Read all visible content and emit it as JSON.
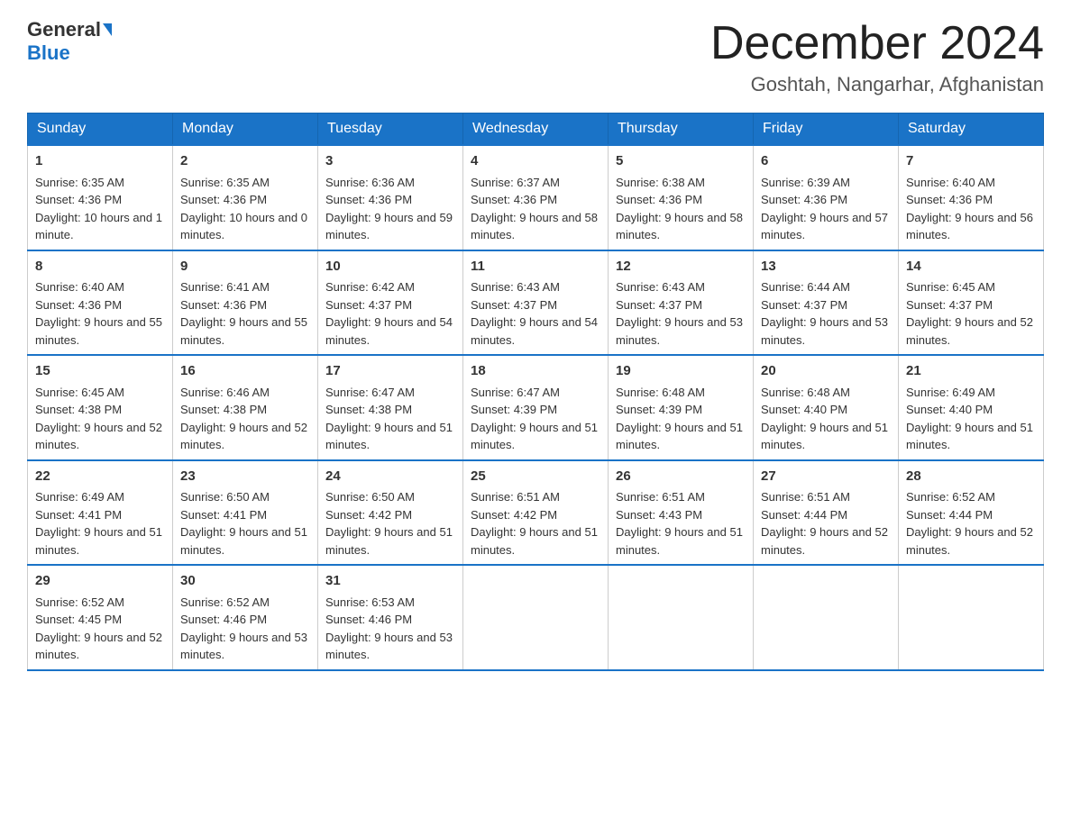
{
  "header": {
    "logo_general": "General",
    "logo_blue": "Blue",
    "month_title": "December 2024",
    "location": "Goshtah, Nangarhar, Afghanistan"
  },
  "weekdays": [
    "Sunday",
    "Monday",
    "Tuesday",
    "Wednesday",
    "Thursday",
    "Friday",
    "Saturday"
  ],
  "weeks": [
    [
      {
        "day": "1",
        "sunrise": "Sunrise: 6:35 AM",
        "sunset": "Sunset: 4:36 PM",
        "daylight": "Daylight: 10 hours and 1 minute."
      },
      {
        "day": "2",
        "sunrise": "Sunrise: 6:35 AM",
        "sunset": "Sunset: 4:36 PM",
        "daylight": "Daylight: 10 hours and 0 minutes."
      },
      {
        "day": "3",
        "sunrise": "Sunrise: 6:36 AM",
        "sunset": "Sunset: 4:36 PM",
        "daylight": "Daylight: 9 hours and 59 minutes."
      },
      {
        "day": "4",
        "sunrise": "Sunrise: 6:37 AM",
        "sunset": "Sunset: 4:36 PM",
        "daylight": "Daylight: 9 hours and 58 minutes."
      },
      {
        "day": "5",
        "sunrise": "Sunrise: 6:38 AM",
        "sunset": "Sunset: 4:36 PM",
        "daylight": "Daylight: 9 hours and 58 minutes."
      },
      {
        "day": "6",
        "sunrise": "Sunrise: 6:39 AM",
        "sunset": "Sunset: 4:36 PM",
        "daylight": "Daylight: 9 hours and 57 minutes."
      },
      {
        "day": "7",
        "sunrise": "Sunrise: 6:40 AM",
        "sunset": "Sunset: 4:36 PM",
        "daylight": "Daylight: 9 hours and 56 minutes."
      }
    ],
    [
      {
        "day": "8",
        "sunrise": "Sunrise: 6:40 AM",
        "sunset": "Sunset: 4:36 PM",
        "daylight": "Daylight: 9 hours and 55 minutes."
      },
      {
        "day": "9",
        "sunrise": "Sunrise: 6:41 AM",
        "sunset": "Sunset: 4:36 PM",
        "daylight": "Daylight: 9 hours and 55 minutes."
      },
      {
        "day": "10",
        "sunrise": "Sunrise: 6:42 AM",
        "sunset": "Sunset: 4:37 PM",
        "daylight": "Daylight: 9 hours and 54 minutes."
      },
      {
        "day": "11",
        "sunrise": "Sunrise: 6:43 AM",
        "sunset": "Sunset: 4:37 PM",
        "daylight": "Daylight: 9 hours and 54 minutes."
      },
      {
        "day": "12",
        "sunrise": "Sunrise: 6:43 AM",
        "sunset": "Sunset: 4:37 PM",
        "daylight": "Daylight: 9 hours and 53 minutes."
      },
      {
        "day": "13",
        "sunrise": "Sunrise: 6:44 AM",
        "sunset": "Sunset: 4:37 PM",
        "daylight": "Daylight: 9 hours and 53 minutes."
      },
      {
        "day": "14",
        "sunrise": "Sunrise: 6:45 AM",
        "sunset": "Sunset: 4:37 PM",
        "daylight": "Daylight: 9 hours and 52 minutes."
      }
    ],
    [
      {
        "day": "15",
        "sunrise": "Sunrise: 6:45 AM",
        "sunset": "Sunset: 4:38 PM",
        "daylight": "Daylight: 9 hours and 52 minutes."
      },
      {
        "day": "16",
        "sunrise": "Sunrise: 6:46 AM",
        "sunset": "Sunset: 4:38 PM",
        "daylight": "Daylight: 9 hours and 52 minutes."
      },
      {
        "day": "17",
        "sunrise": "Sunrise: 6:47 AM",
        "sunset": "Sunset: 4:38 PM",
        "daylight": "Daylight: 9 hours and 51 minutes."
      },
      {
        "day": "18",
        "sunrise": "Sunrise: 6:47 AM",
        "sunset": "Sunset: 4:39 PM",
        "daylight": "Daylight: 9 hours and 51 minutes."
      },
      {
        "day": "19",
        "sunrise": "Sunrise: 6:48 AM",
        "sunset": "Sunset: 4:39 PM",
        "daylight": "Daylight: 9 hours and 51 minutes."
      },
      {
        "day": "20",
        "sunrise": "Sunrise: 6:48 AM",
        "sunset": "Sunset: 4:40 PM",
        "daylight": "Daylight: 9 hours and 51 minutes."
      },
      {
        "day": "21",
        "sunrise": "Sunrise: 6:49 AM",
        "sunset": "Sunset: 4:40 PM",
        "daylight": "Daylight: 9 hours and 51 minutes."
      }
    ],
    [
      {
        "day": "22",
        "sunrise": "Sunrise: 6:49 AM",
        "sunset": "Sunset: 4:41 PM",
        "daylight": "Daylight: 9 hours and 51 minutes."
      },
      {
        "day": "23",
        "sunrise": "Sunrise: 6:50 AM",
        "sunset": "Sunset: 4:41 PM",
        "daylight": "Daylight: 9 hours and 51 minutes."
      },
      {
        "day": "24",
        "sunrise": "Sunrise: 6:50 AM",
        "sunset": "Sunset: 4:42 PM",
        "daylight": "Daylight: 9 hours and 51 minutes."
      },
      {
        "day": "25",
        "sunrise": "Sunrise: 6:51 AM",
        "sunset": "Sunset: 4:42 PM",
        "daylight": "Daylight: 9 hours and 51 minutes."
      },
      {
        "day": "26",
        "sunrise": "Sunrise: 6:51 AM",
        "sunset": "Sunset: 4:43 PM",
        "daylight": "Daylight: 9 hours and 51 minutes."
      },
      {
        "day": "27",
        "sunrise": "Sunrise: 6:51 AM",
        "sunset": "Sunset: 4:44 PM",
        "daylight": "Daylight: 9 hours and 52 minutes."
      },
      {
        "day": "28",
        "sunrise": "Sunrise: 6:52 AM",
        "sunset": "Sunset: 4:44 PM",
        "daylight": "Daylight: 9 hours and 52 minutes."
      }
    ],
    [
      {
        "day": "29",
        "sunrise": "Sunrise: 6:52 AM",
        "sunset": "Sunset: 4:45 PM",
        "daylight": "Daylight: 9 hours and 52 minutes."
      },
      {
        "day": "30",
        "sunrise": "Sunrise: 6:52 AM",
        "sunset": "Sunset: 4:46 PM",
        "daylight": "Daylight: 9 hours and 53 minutes."
      },
      {
        "day": "31",
        "sunrise": "Sunrise: 6:53 AM",
        "sunset": "Sunset: 4:46 PM",
        "daylight": "Daylight: 9 hours and 53 minutes."
      },
      null,
      null,
      null,
      null
    ]
  ]
}
